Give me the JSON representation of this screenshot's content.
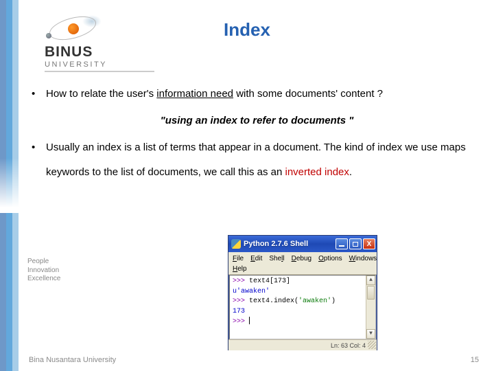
{
  "logo": {
    "brand": "BINUS",
    "sub": "UNIVERSITY"
  },
  "title": "Index",
  "bullets": {
    "first_a": "How to relate the user's ",
    "first_underlined": "information need",
    "first_b": " with some documents' content ?",
    "quote": "\"using an index to refer to documents \"",
    "second_a": "Usually an index is a list of terms that appear in a document. The kind of index we use maps keywords to the  list of documents, we call this as  an ",
    "second_red": "inverted index",
    "second_b": "."
  },
  "tagline": {
    "l1": "People",
    "l2": "Innovation",
    "l3": "Excellence"
  },
  "footer": {
    "left": "Bina Nusantara University",
    "page": "15"
  },
  "pythonShell": {
    "title": "Python 2.7.6 Shell",
    "menu": {
      "file": "File",
      "edit": "Edit",
      "shell": "Shell",
      "debug": "Debug",
      "options": "Options",
      "windows": "Windows",
      "help": "Help"
    },
    "lines": {
      "p1": ">>> ",
      "c1": "text4[173]",
      "r1": "u'awaken'",
      "p2": ">>> ",
      "c2a": "text4.index(",
      "c2b": "'awaken'",
      "c2c": ")",
      "r2": "173",
      "p3": ">>> "
    },
    "status": "Ln: 63 Col: 4"
  }
}
